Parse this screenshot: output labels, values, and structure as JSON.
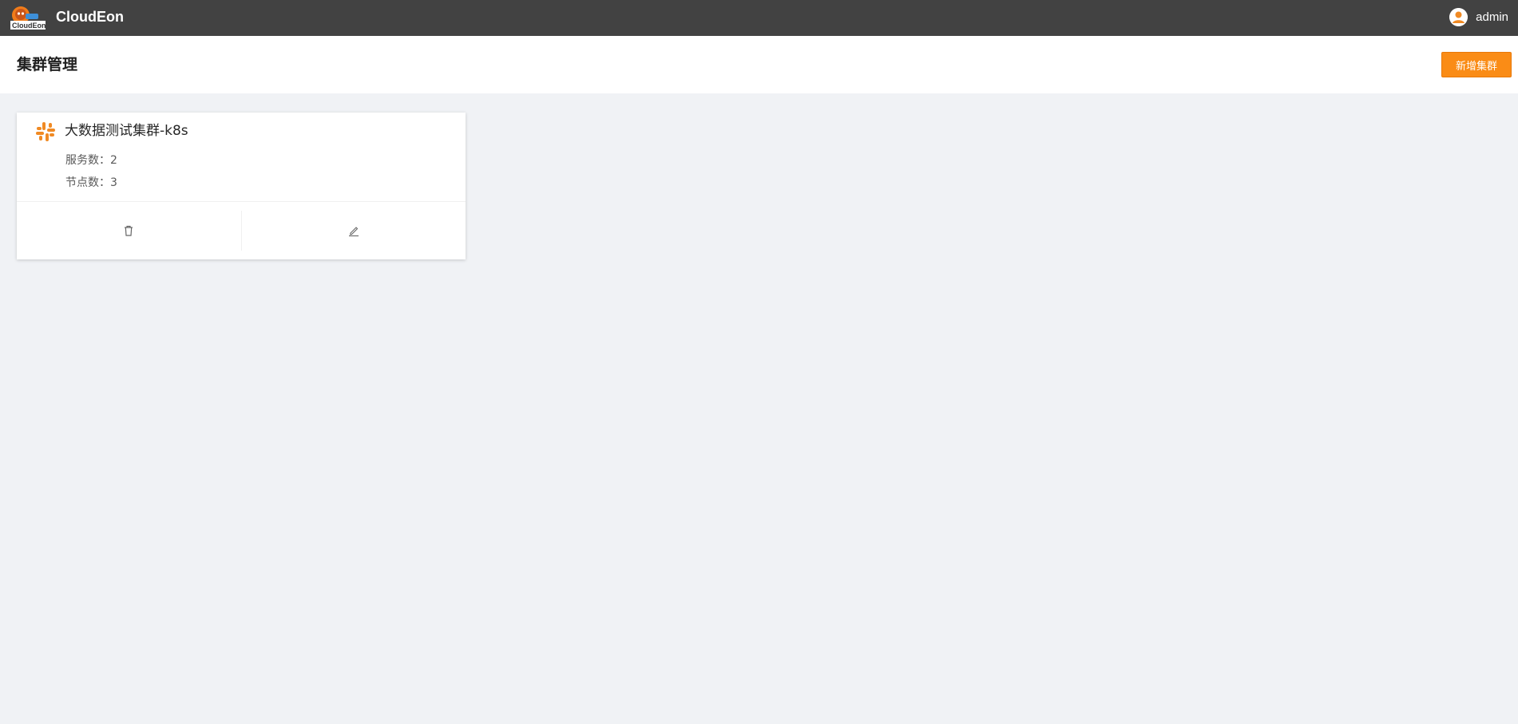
{
  "app": {
    "title": "CloudEon",
    "logo_text": "CloudEon"
  },
  "user": {
    "name": "admin",
    "icon": "user-avatar-icon"
  },
  "header": {
    "title": "集群管理",
    "add_button_label": "新增集群"
  },
  "clusters": [
    {
      "name": "大数据测试集群-k8s",
      "icon": "slack-like-cluster-icon",
      "services_label": "服务数：",
      "services_count": "2",
      "nodes_label": "节点数：",
      "nodes_count": "3",
      "actions": [
        {
          "icon": "trash-icon",
          "label": "delete"
        },
        {
          "icon": "edit-icon",
          "label": "edit"
        }
      ]
    }
  ],
  "colors": {
    "topbar": "#424242",
    "accent": "#fa8c16",
    "background": "#f0f2f5"
  }
}
